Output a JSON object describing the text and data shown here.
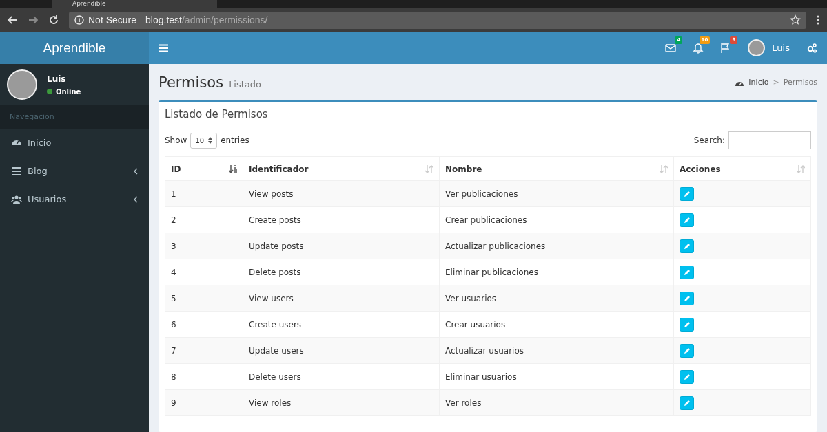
{
  "browser": {
    "tab_title": "Aprendible",
    "security": "Not Secure",
    "url_host": "blog.test",
    "url_path": "/admin/permissions/"
  },
  "header": {
    "logo": "Aprendible",
    "notifications": [
      {
        "kind": "mail",
        "count": "4",
        "color": "#00a65a"
      },
      {
        "kind": "bell",
        "count": "10",
        "color": "#f39c12"
      },
      {
        "kind": "flag",
        "count": "9",
        "color": "#dd4b39"
      }
    ],
    "user": "Luis"
  },
  "sidebar": {
    "user": {
      "name": "Luis",
      "status": "Online"
    },
    "section": "Navegación",
    "items": [
      {
        "kind": "dashboard",
        "label": "Inicio",
        "expandable": false
      },
      {
        "kind": "list",
        "label": "Blog",
        "expandable": true
      },
      {
        "kind": "users",
        "label": "Usuarios",
        "expandable": true
      }
    ]
  },
  "page": {
    "title": "Permisos",
    "subtitle": "Listado",
    "breadcrumb": [
      "Inicio",
      "Permisos"
    ],
    "breadcrumb_separator": ">"
  },
  "box": {
    "title": "Listado de Permisos",
    "show_label": "Show",
    "page_size": "10",
    "entries_label": "entries",
    "search_label": "Search:",
    "columns": [
      {
        "label": "ID",
        "sorted": true
      },
      {
        "label": "Identificador",
        "sorted": false
      },
      {
        "label": "Nombre",
        "sorted": false
      },
      {
        "label": "Acciones",
        "sorted": false
      }
    ],
    "rows": [
      [
        "1",
        "View posts",
        "Ver publicaciones"
      ],
      [
        "2",
        "Create posts",
        "Crear publicaciones"
      ],
      [
        "3",
        "Update posts",
        "Actualizar publicaciones"
      ],
      [
        "4",
        "Delete posts",
        "Eliminar publicaciones"
      ],
      [
        "5",
        "View users",
        "Ver usuarios"
      ],
      [
        "6",
        "Create users",
        "Crear usuarios"
      ],
      [
        "7",
        "Update users",
        "Actualizar usuarios"
      ],
      [
        "8",
        "Delete users",
        "Eliminar usuarios"
      ],
      [
        "9",
        "View roles",
        "Ver roles"
      ]
    ]
  }
}
